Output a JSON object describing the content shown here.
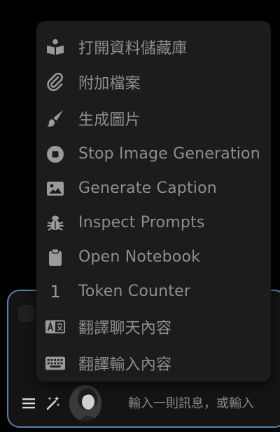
{
  "menu": {
    "items": [
      {
        "label": "打開資料儲藏庫",
        "icon": "book-reader-icon"
      },
      {
        "label": "附加檔案",
        "icon": "paperclip-icon"
      },
      {
        "label": "生成圖片",
        "icon": "paintbrush-icon"
      },
      {
        "label": "Stop Image Generation",
        "icon": "stop-circle-icon"
      },
      {
        "label": "Generate Caption",
        "icon": "image-icon"
      },
      {
        "label": "Inspect Prompts",
        "icon": "bug-icon"
      },
      {
        "label": "Open Notebook",
        "icon": "clipboard-icon"
      },
      {
        "label": "Token Counter",
        "icon": "number-one-icon",
        "glyph": "1"
      },
      {
        "label": "翻譯聊天內容",
        "icon": "translate-icon"
      },
      {
        "label": "翻譯輸入內容",
        "icon": "keyboard-icon"
      }
    ]
  },
  "composer": {
    "placeholder": "輸入一則訊息，或輸入"
  },
  "colors": {
    "menu_bg": "#1c1c1c",
    "menu_text": "#8e8e8e",
    "composer_border": "#5a7fb0",
    "background": "#000000"
  }
}
